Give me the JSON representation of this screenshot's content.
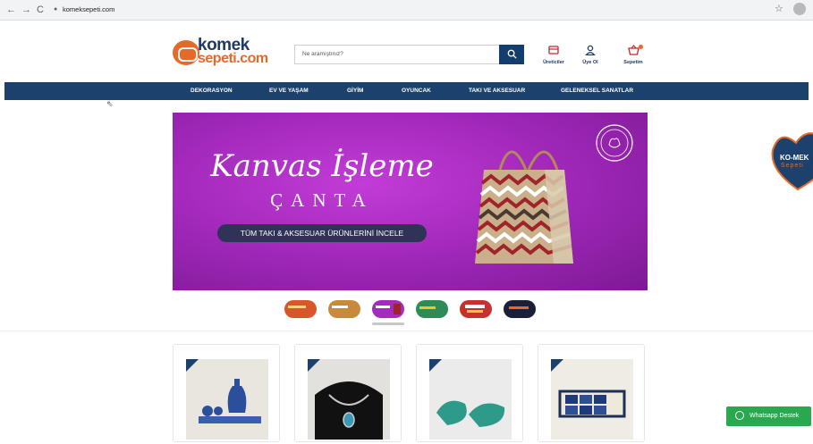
{
  "browser": {
    "url": "komeksepeti.com",
    "back_icon": "←",
    "forward_icon": "→",
    "reload_icon": "C",
    "lock_icon": "🔒",
    "bookmark_icon": "☆"
  },
  "header": {
    "logo_top": "komek",
    "logo_bottom": "sepeti.com",
    "search_placeholder": "Ne aramıştınız?",
    "search_icon": "⌕",
    "producers_label": "Üreticiler",
    "signup_label": "Üye Ol",
    "cart_label": "Sepetim",
    "producers_icon": "☰",
    "signup_icon": "♙",
    "cart_icon": "⌂"
  },
  "nav": {
    "items": [
      "DEKORASYON",
      "EV VE YAŞAM",
      "GİYİM",
      "OYUNCAK",
      "TAKI VE AKSESUAR",
      "GELENEKSEL SANATLAR"
    ]
  },
  "banner": {
    "script_title": "Kanvas İşleme",
    "subtitle": "ÇANTA",
    "cta": "TÜM TAKI & AKSESUAR ÜRÜNLERİNİ İNCELE",
    "colors": {
      "bg": "#a32bbd",
      "cta": "#2f3358"
    }
  },
  "slider": {
    "active_index": 2,
    "thumbs": [
      {
        "color": "#d8572a"
      },
      {
        "color": "#c9893d"
      },
      {
        "color": "#a32bbd"
      },
      {
        "color": "#2e8b57"
      },
      {
        "color": "#c7302f"
      },
      {
        "color": "#1a1f3a"
      }
    ]
  },
  "side_widget": {
    "line1": "KO-MEK",
    "line2": "Sepeti"
  },
  "products": [
    {
      "name": "ceramic-vase-set"
    },
    {
      "name": "necklace"
    },
    {
      "name": "green-slippers"
    },
    {
      "name": "tile-tray"
    }
  ],
  "whatsapp": {
    "label": "Whatsapp Destek",
    "color": "#2aa84f"
  },
  "colors": {
    "navy": "#1c416c",
    "accent": "#e7692a",
    "red": "#c2262b"
  }
}
